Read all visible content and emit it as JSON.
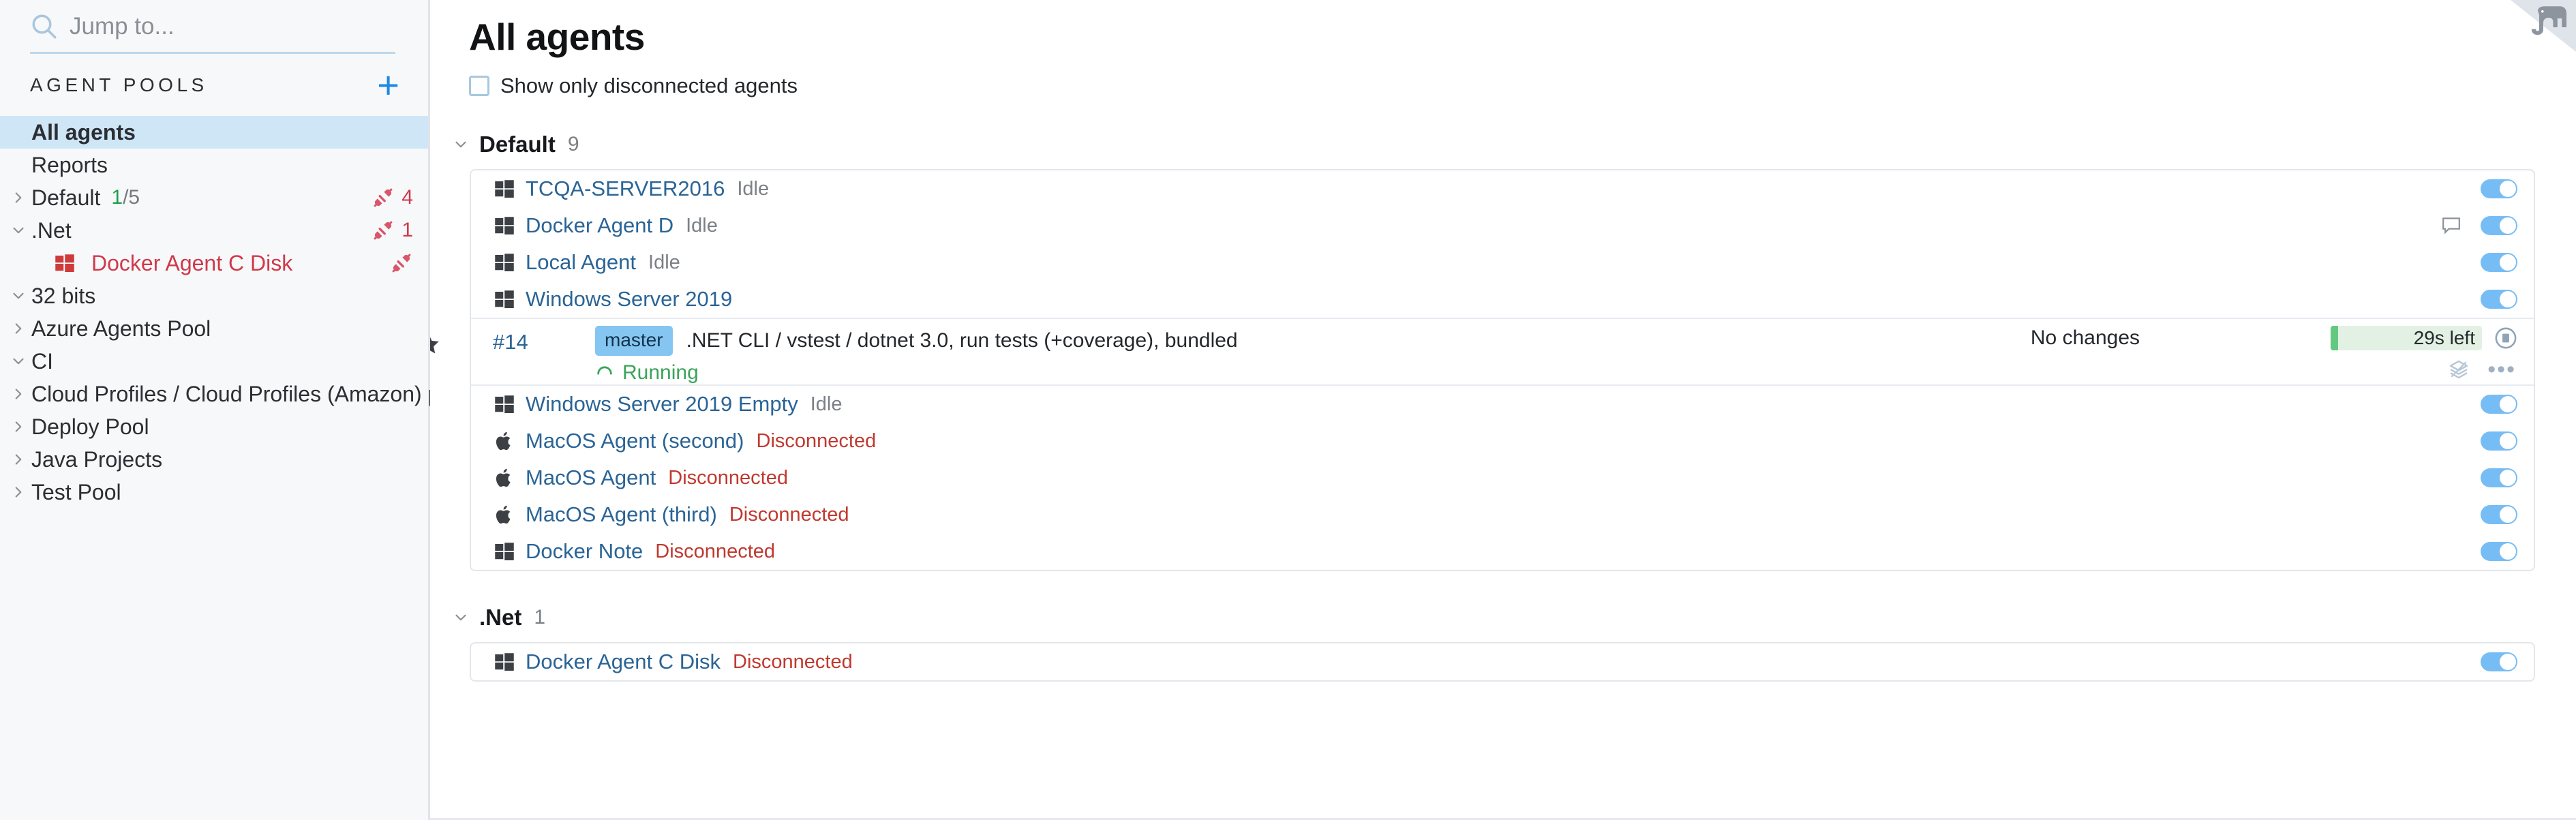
{
  "sidebar": {
    "search": {
      "placeholder": "Jump to...",
      "value": "",
      "icon": "search-icon"
    },
    "section_title": "AGENT POOLS",
    "add_button": "+",
    "items": [
      {
        "label": "All agents",
        "selected": true,
        "chevron": "",
        "counts": null,
        "badge": null,
        "icon": null,
        "child": false
      },
      {
        "label": "Reports",
        "selected": false,
        "chevron": "",
        "counts": null,
        "badge": null,
        "icon": null,
        "child": false
      },
      {
        "label": "Default",
        "selected": false,
        "chevron": "right",
        "counts": {
          "connected": "1",
          "total": "/5"
        },
        "badge": "4",
        "icon": null,
        "child": false
      },
      {
        "label": ".Net",
        "selected": false,
        "chevron": "down",
        "counts": null,
        "badge": "1",
        "icon": null,
        "child": false
      },
      {
        "label": "Docker Agent C Disk",
        "selected": false,
        "chevron": "",
        "counts": null,
        "badge": "",
        "icon": "windows-icon",
        "child": true
      },
      {
        "label": "32 bits",
        "selected": false,
        "chevron": "down",
        "counts": null,
        "badge": null,
        "icon": null,
        "child": false
      },
      {
        "label": "Azure Agents Pool",
        "selected": false,
        "chevron": "right",
        "counts": null,
        "badge": null,
        "icon": null,
        "child": false
      },
      {
        "label": "CI",
        "selected": false,
        "chevron": "down",
        "counts": null,
        "badge": null,
        "icon": null,
        "child": false
      },
      {
        "label": "Cloud Profiles / Cloud Profiles (Amazon) project",
        "selected": false,
        "chevron": "right",
        "counts": null,
        "badge": null,
        "icon": null,
        "child": false
      },
      {
        "label": "Deploy Pool",
        "selected": false,
        "chevron": "right",
        "counts": null,
        "badge": null,
        "icon": null,
        "child": false
      },
      {
        "label": "Java Projects",
        "selected": false,
        "chevron": "right",
        "counts": null,
        "badge": null,
        "icon": null,
        "child": false
      },
      {
        "label": "Test Pool",
        "selected": false,
        "chevron": "right",
        "counts": null,
        "badge": null,
        "icon": null,
        "child": false
      }
    ]
  },
  "main": {
    "title": "All agents",
    "filter": {
      "label": "Show only disconnected agents",
      "checked": false
    },
    "groups": [
      {
        "name": "Default",
        "count": "9",
        "expanded": true,
        "agents": [
          {
            "name": "TCQA-SERVER2016",
            "status": "Idle",
            "status_kind": "idle",
            "os": "windows-icon",
            "toggle": true,
            "comment": false
          },
          {
            "name": "Docker Agent D",
            "status": "Idle",
            "status_kind": "idle",
            "os": "windows-icon",
            "toggle": true,
            "comment": true
          },
          {
            "name": "Local Agent",
            "status": "Idle",
            "status_kind": "idle",
            "os": "windows-icon",
            "toggle": true,
            "comment": false
          },
          {
            "name": "Windows Server 2019",
            "status": "",
            "status_kind": "idle",
            "os": "windows-icon",
            "toggle": true,
            "comment": false
          },
          {
            "build": {
              "starred": true,
              "number": "#14",
              "branch": "master",
              "description": ".NET CLI / vstest / dotnet 3.0, run tests (+coverage), bundled",
              "state": "Running",
              "changes": "No changes",
              "time_left": "29s left",
              "progress_percent": 5
            }
          },
          {
            "name": "Windows Server 2019 Empty",
            "status": "Idle",
            "status_kind": "idle",
            "os": "windows-icon",
            "toggle": true,
            "comment": false
          },
          {
            "name": "MacOS Agent (second)",
            "status": "Disconnected",
            "status_kind": "disc",
            "os": "apple-icon",
            "toggle": true,
            "comment": false
          },
          {
            "name": "MacOS Agent",
            "status": "Disconnected",
            "status_kind": "disc",
            "os": "apple-icon",
            "toggle": true,
            "comment": false
          },
          {
            "name": "MacOS Agent (third)",
            "status": "Disconnected",
            "status_kind": "disc",
            "os": "apple-icon",
            "toggle": true,
            "comment": false
          },
          {
            "name": "Docker Note",
            "status": "Disconnected",
            "status_kind": "disc",
            "os": "windows-icon",
            "toggle": true,
            "comment": false
          }
        ]
      },
      {
        "name": ".Net",
        "count": "1",
        "expanded": true,
        "agents": [
          {
            "name": "Docker Agent C Disk",
            "status": "Disconnected",
            "status_kind": "disc",
            "os": "windows-icon",
            "toggle": true,
            "comment": false
          }
        ]
      }
    ]
  },
  "corner": {
    "icon": "elephant-icon"
  },
  "colors": {
    "accent_blue": "#1e88e5",
    "link_blue": "#2a6496",
    "selected_bg": "#cfe6f7",
    "disconnected_red": "#c0392f",
    "running_green": "#3aa45a",
    "toggle_on": "#77bdf5",
    "branch_chip": "#85c5f2",
    "progress_track": "#e3f1e4",
    "progress_fill": "#63c97e"
  }
}
